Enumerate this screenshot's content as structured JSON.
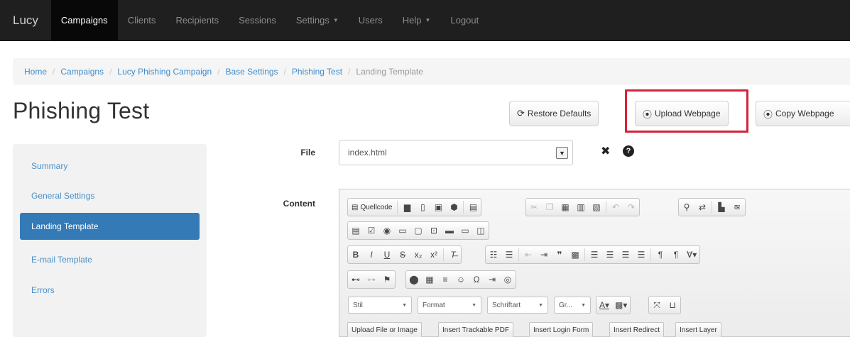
{
  "nav": {
    "brand": "Lucy",
    "items": [
      "Campaigns",
      "Clients",
      "Recipients",
      "Sessions",
      "Settings",
      "Users",
      "Help",
      "Logout"
    ]
  },
  "breadcrumb": [
    "Home",
    "Campaigns",
    "Lucy Phishing Campaign",
    "Base Settings",
    "Phishing Test",
    "Landing Template"
  ],
  "page": {
    "title": "Phishing Test",
    "restore_label": "Restore Defaults",
    "upload_label": "Upload Webpage",
    "copy_label": "Copy Webpage"
  },
  "sidebar": {
    "items": [
      "Summary",
      "General Settings",
      "Landing Template",
      "E-mail Template",
      "Errors"
    ],
    "active": "Landing Template"
  },
  "form": {
    "file_label": "File",
    "file_value": "index.html",
    "content_label": "Content"
  },
  "editor": {
    "source_label": "Quellcode",
    "combos": [
      "Stil",
      "Format",
      "Schriftart",
      "Gr..."
    ],
    "custom_buttons": [
      "Upload File or Image",
      "Insert Trackable PDF",
      "Insert Login Form",
      "Insert Redirect",
      "Insert Layer"
    ]
  },
  "colors": {
    "navbar": "#1f1f1f",
    "link": "#3f8ccd",
    "active_sidebar": "#337ab7",
    "highlight": "#d3243a"
  }
}
